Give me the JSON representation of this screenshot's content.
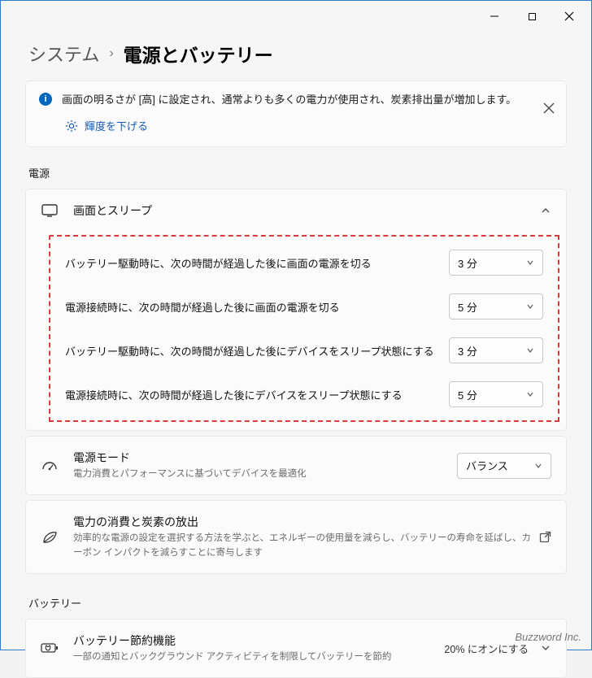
{
  "breadcrumb": {
    "parent": "システム",
    "current": "電源とバッテリー"
  },
  "notice": {
    "text": "画面の明るさが [高] に設定され、通常よりも多くの電力が使用され、炭素排出量が増加します。",
    "action_label": "輝度を下げる"
  },
  "sections": {
    "power_title": "電源",
    "battery_title": "バッテリー"
  },
  "screen_sleep": {
    "title": "画面とスリープ",
    "rows": [
      {
        "label": "バッテリー駆動時に、次の時間が経過した後に画面の電源を切る",
        "value": "3 分"
      },
      {
        "label": "電源接続時に、次の時間が経過した後に画面の電源を切る",
        "value": "5 分"
      },
      {
        "label": "バッテリー駆動時に、次の時間が経過した後にデバイスをスリープ状態にする",
        "value": "3 分"
      },
      {
        "label": "電源接続時に、次の時間が経過した後にデバイスをスリープ状態にする",
        "value": "5 分"
      }
    ]
  },
  "power_mode": {
    "title": "電源モード",
    "sub": "電力消費とパフォーマンスに基づいてデバイスを最適化",
    "value": "バランス"
  },
  "energy": {
    "title": "電力の消費と炭素の放出",
    "sub": "効率的な電源の設定を選択する方法を学ぶと、エネルギーの使用量を減らし、バッテリーの寿命を延ばし、カーボン インパクトを減らすことに寄与します"
  },
  "battery_saver": {
    "title": "バッテリー節約機能",
    "sub": "一部の通知とバックグラウンド アクティビティを制限してバッテリーを節約",
    "value": "20% にオンにする"
  },
  "watermark": "Buzzword Inc."
}
